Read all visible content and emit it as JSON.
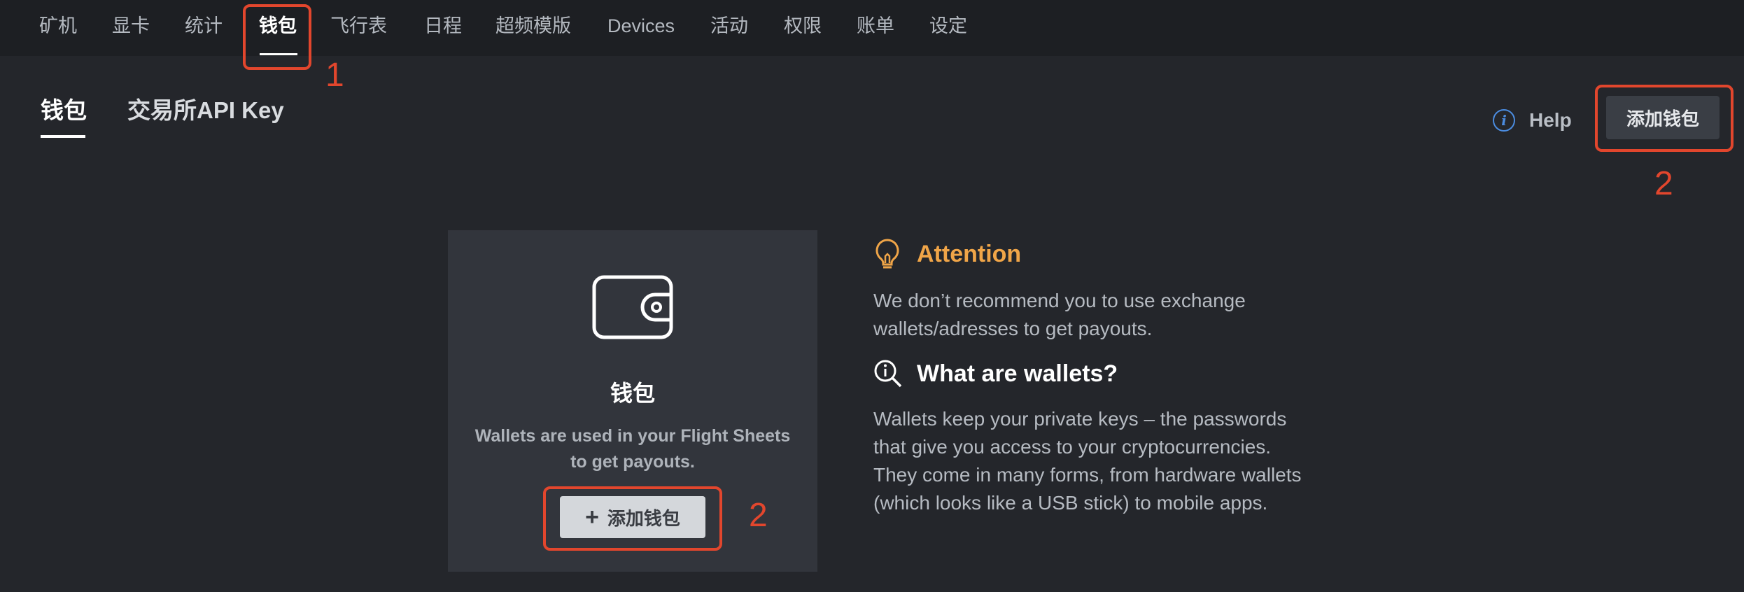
{
  "nav": {
    "items": [
      "矿机",
      "显卡",
      "统计",
      "钱包",
      "飞行表",
      "日程",
      "超频模版",
      "Devices",
      "活动",
      "权限",
      "账单",
      "设定"
    ],
    "active_index": 3
  },
  "subtabs": [
    "钱包",
    "交易所API Key"
  ],
  "help": {
    "icon": "info-icon",
    "label": "Help"
  },
  "header_add_button": "添加钱包",
  "card": {
    "icon": "wallet-icon",
    "title": "钱包",
    "description": "Wallets are used in your Flight Sheets to get payouts.",
    "add_button": "添加钱包"
  },
  "attention": {
    "icon": "lightbulb-icon",
    "title": "Attention",
    "text": "We don’t recommend you to use exchange wallets/adresses to get payouts."
  },
  "what_are_wallets": {
    "icon": "search-info-icon",
    "title": "What are wallets?",
    "text": "Wallets keep your private keys – the passwords that give you access to your cryptocurrencies. They come in many forms, from hardware wallets (which looks like a USB stick) to mobile apps."
  },
  "annotations": [
    "1",
    "2",
    "2"
  ],
  "colors": {
    "annotation": "#e2462d",
    "attention": "#f0a548",
    "help": "#4b8ce0"
  }
}
